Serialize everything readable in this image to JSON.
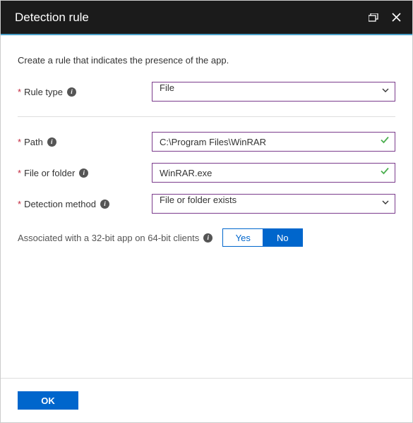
{
  "header": {
    "title": "Detection rule"
  },
  "subtitle": "Create a rule that indicates the presence of the app.",
  "fields": {
    "rule_type": {
      "label": "Rule type",
      "value": "File"
    },
    "path": {
      "label": "Path",
      "value": "C:\\Program Files\\WinRAR"
    },
    "file_or_folder": {
      "label": "File or folder",
      "value": "WinRAR.exe"
    },
    "detection_method": {
      "label": "Detection method",
      "value": "File or folder exists"
    }
  },
  "assoc": {
    "label": "Associated with a 32-bit app on 64-bit clients",
    "yes": "Yes",
    "no": "No",
    "selected": "No"
  },
  "footer": {
    "ok": "OK"
  },
  "icons": {
    "info_glyph": "i"
  }
}
